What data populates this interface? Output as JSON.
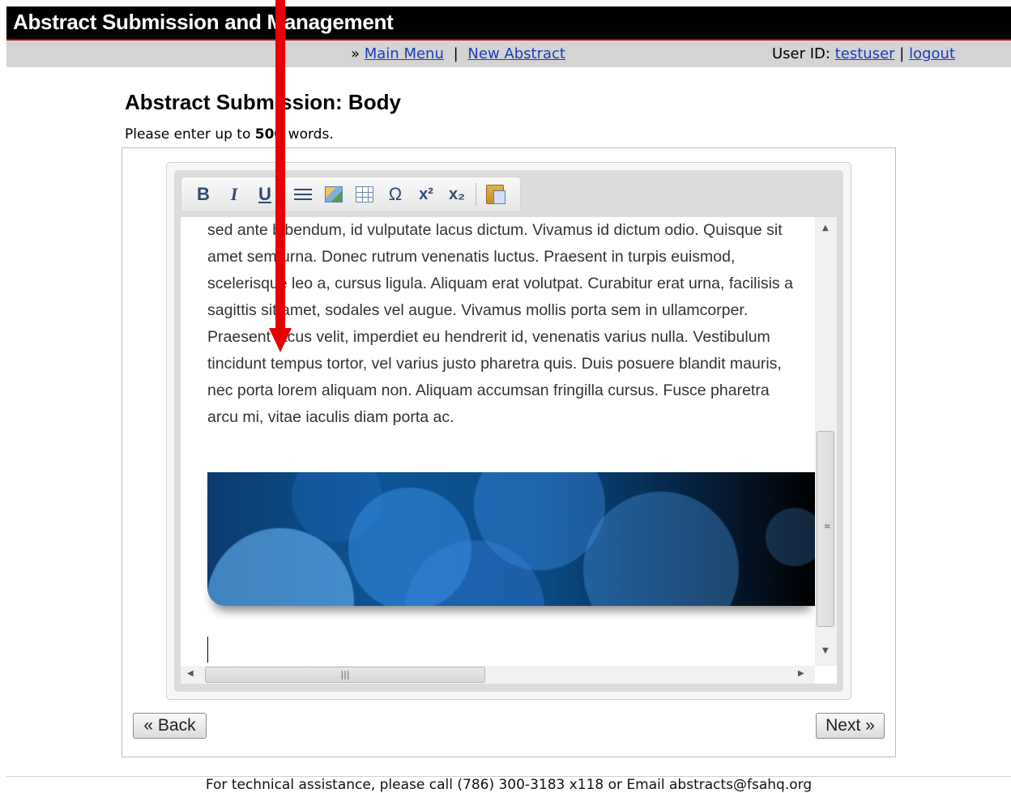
{
  "app": {
    "title": "Abstract Submission and Management"
  },
  "nav": {
    "prefix": "»",
    "main_menu": "Main Menu",
    "separator": "|",
    "new_abstract": "New Abstract",
    "user_label": "User ID:",
    "user_id": "testuser",
    "logout": "logout"
  },
  "page": {
    "heading": "Abstract Submission: Body",
    "instructions_pre": "Please enter up to ",
    "word_limit": "500",
    "instructions_post": " words."
  },
  "toolbar": {
    "buttons": [
      "bold",
      "italic",
      "underline",
      "bulleted-list",
      "insert-image",
      "insert-table",
      "special-character",
      "superscript",
      "subscript",
      "paste-from-word"
    ],
    "bold": "B",
    "italic": "I",
    "underline": "U",
    "omega": "Ω",
    "superscript": "x²",
    "subscript": "x₂"
  },
  "editor": {
    "body_text": "sed ante bibendum, id vulputate lacus dictum. Vivamus id dictum odio. Quisque sit amet sem urna. Donec rutrum venenatis luctus. Praesent in turpis euismod, scelerisque leo a, cursus ligula. Aliquam erat volutpat. Curabitur erat urna, facilisis a sagittis sit amet, sodales vel augue. Vivamus mollis porta sem in ullamcorper. Praesent lacus velit, imperdiet eu hendrerit id, venenatis varius nulla. Vestibulum tincidunt tempus tortor, vel varius justo pharetra quis. Duis posuere blandit mauris, nec porta lorem aliquam non. Aliquam accumsan fringilla cursus. Fusce pharetra arcu mi, vitae iaculis diam porta ac.",
    "image": "blue-bubbles-banner"
  },
  "buttons": {
    "back": "« Back",
    "next": "Next »"
  },
  "footer": {
    "text": "For technical assistance, please call (786) 300-3183 x118 or Email abstracts@fsahq.org"
  },
  "colors": {
    "header_bg": "#000000",
    "nav_bg": "#d4d4d4",
    "link": "#1a3bbd",
    "annotation_arrow": "#e60000"
  }
}
